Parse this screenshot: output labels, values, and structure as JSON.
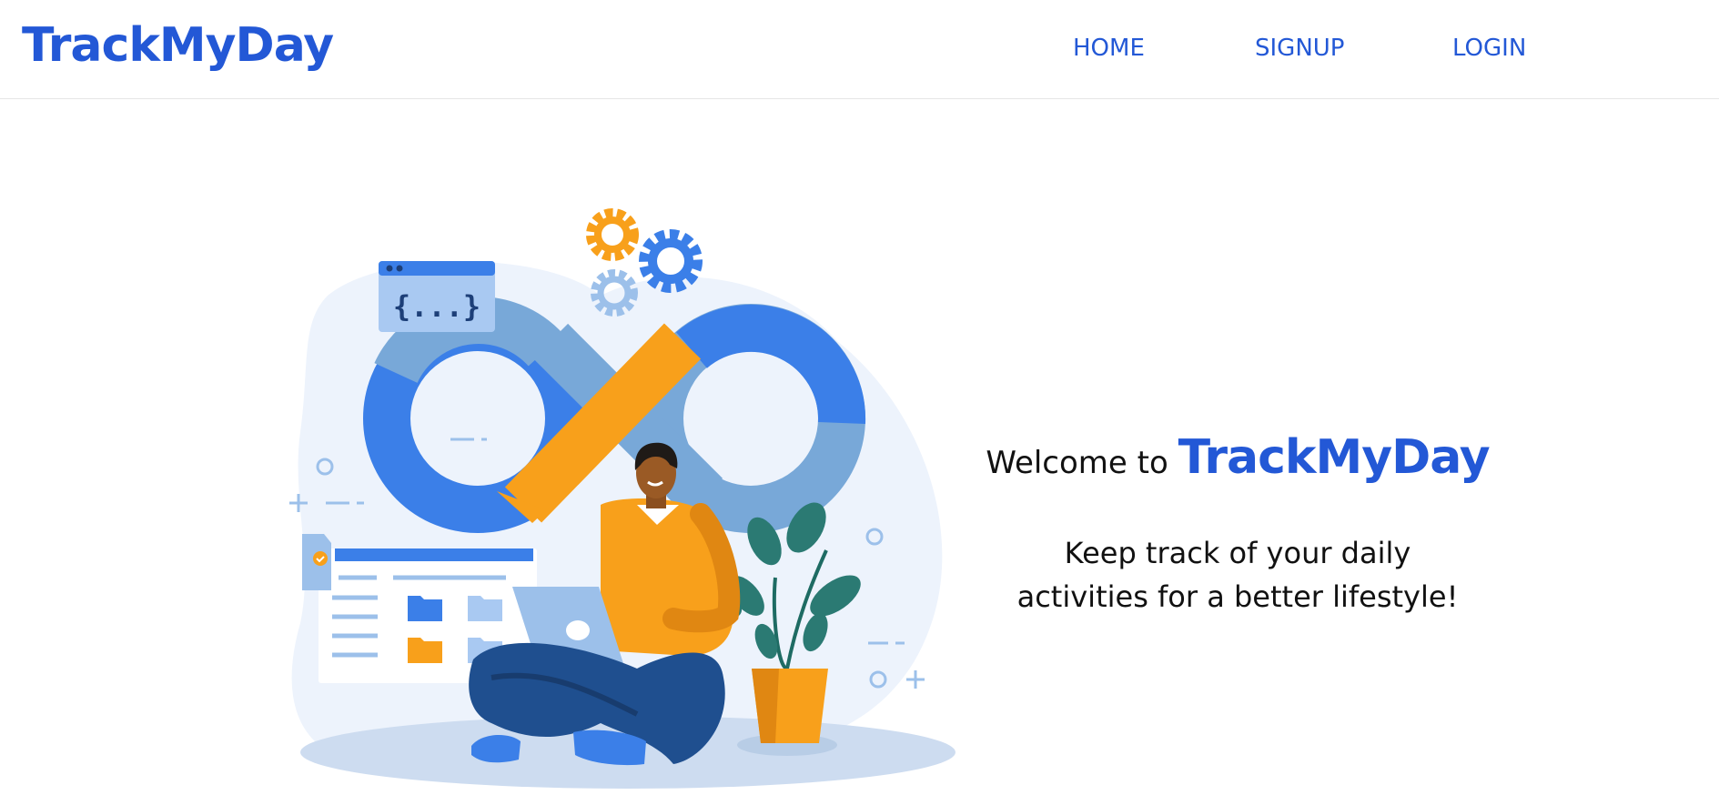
{
  "navbar": {
    "brand": "TrackMyDay",
    "links": [
      {
        "label": "HOME"
      },
      {
        "label": "SIGNUP"
      },
      {
        "label": "LOGIN"
      }
    ]
  },
  "hero": {
    "welcome_prefix": "Welcome to",
    "welcome_brand": "TrackMyDay",
    "tagline_line1": "Keep track of your daily",
    "tagline_line2": "activities for a better lifestyle!",
    "illustration": {
      "code_window_text": "{...}",
      "icons": [
        "infinity-loop-icon",
        "gear-icon",
        "code-window-icon",
        "folder-icon",
        "laptop-icon",
        "plant-icon"
      ]
    }
  },
  "colors": {
    "brand_blue": "#2358d6",
    "accent_orange": "#f8a01b",
    "light_blue": "#9cc0ea",
    "mid_blue": "#3b7fe8"
  }
}
